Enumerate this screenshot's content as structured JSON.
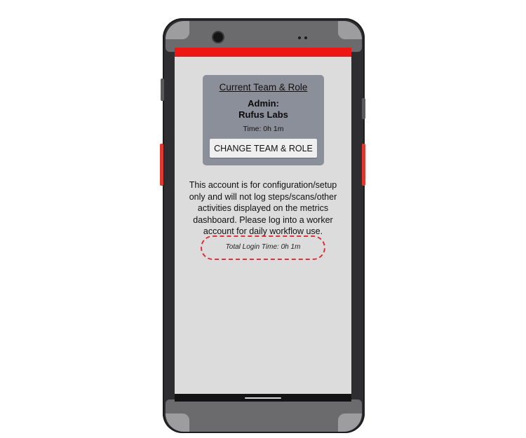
{
  "card": {
    "title": "Current Team & Role",
    "role_line1": "Admin:",
    "role_line2": "Rufus Labs",
    "time": "Time: 0h 1m",
    "change_button_label": "CHANGE TEAM & ROLE"
  },
  "notice": {
    "line1": "This account is for configuration/setup",
    "line2": "only and will not log steps/scans/other",
    "line3": "activities displayed on the metrics",
    "line4": "dashboard. Please log into a worker",
    "line5": "account for daily workflow use."
  },
  "total_login_time": "Total Login Time: 0h 1m",
  "colors": {
    "status_bar": "#ee1515",
    "card_background": "#8b8f99",
    "screen_background": "#dcdcdc",
    "highlight_dashes": "#e0303a",
    "device_accent_keys": "#e0382f"
  },
  "icons": [
    "front-camera-icon",
    "home-indicator-icon"
  ]
}
